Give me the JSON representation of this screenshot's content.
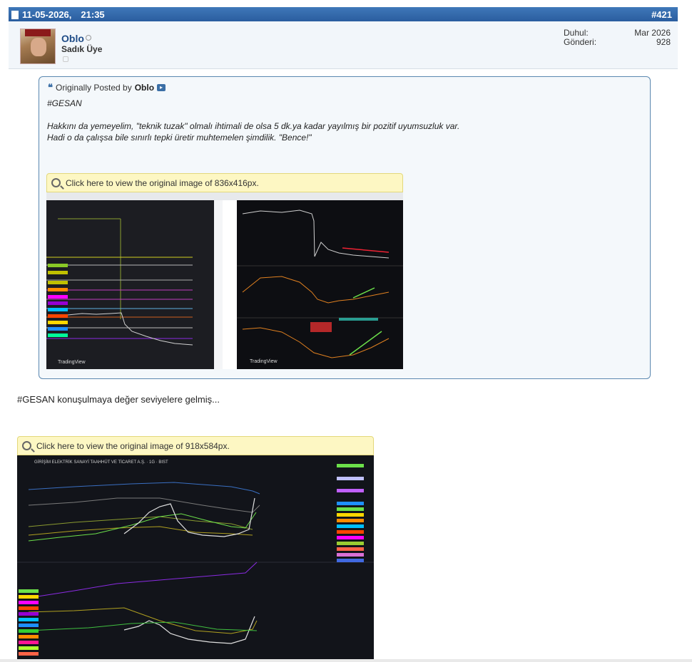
{
  "post": {
    "date": "11-05-2026,",
    "time": "21:35",
    "number": "#421"
  },
  "user": {
    "name": "Oblo",
    "title": "Sadık Üye",
    "joined_label": "Duhul:",
    "joined_value": "Mar 2026",
    "posts_label": "Gönderi:",
    "posts_value": "928"
  },
  "quote": {
    "prefix": "Originally Posted by",
    "author": "Oblo",
    "tag": "#GESAN",
    "line1": "Hakkını da yemeyelim, \"teknik tuzak\" olmalı ihtimali de olsa 5 dk.ya kadar yayılmış bir pozitif uyumsuzluk var.",
    "line2": "Hadi o da çalışsa bile sınırlı tepki üretir muhtemelen şimdilik. \"Bence!\"",
    "image_bar": "Click here to view the original image of 836x416px."
  },
  "message": {
    "text": "#GESAN konuşulmaya değer seviyelere gelmiş...",
    "image_bar": "Click here to view the original image of 918x584px."
  },
  "icons": {
    "doc": "doc-icon",
    "quote": "quote-icon",
    "view_post": "view-post-icon",
    "zoom": "zoom-icon",
    "online": "online-status-icon"
  },
  "chart_watermark": "TradingView",
  "chart_title": "GİRİŞİM ELEKTRİK SANAYİ TAAHHÜT VE TİCARET A.Ş. · 1G · BIST"
}
